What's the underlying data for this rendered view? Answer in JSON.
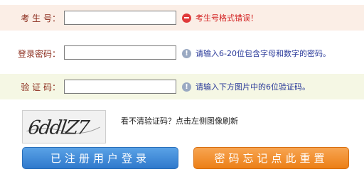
{
  "form": {
    "id_number": {
      "label": "考 生 号：",
      "value": "",
      "hint": "考生号格式错误！"
    },
    "password": {
      "label": "登录密码：",
      "value": "",
      "hint": "请输入6-20位包含字母和数字的密码。"
    },
    "captcha": {
      "label": "验 证 码：",
      "value": "",
      "hint": "请输入下方图片中的6位验证码。"
    }
  },
  "captcha_image": {
    "text": "6ddlZ7"
  },
  "refresh_text": "看不清验证码？点击左侧图像刷新",
  "buttons": {
    "login": "已注册用户登录",
    "reset": "密码忘记点此重置"
  },
  "colors": {
    "error_row": "#fbeee6",
    "verify_row": "#f5f7e4",
    "label": "#8a2a1a",
    "error_text": "#d21f1f",
    "info_text": "#2a3a9a",
    "login_button": "#3f8bd8",
    "reset_button": "#f08a22"
  }
}
